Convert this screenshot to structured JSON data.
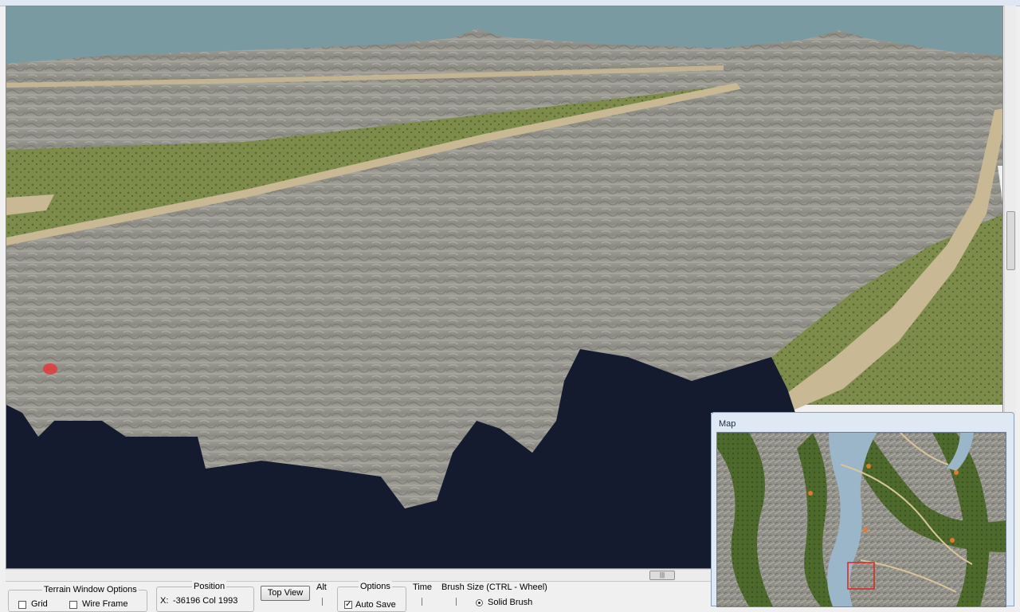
{
  "app": {
    "title_bar_text": ""
  },
  "terrain_window_options": {
    "title": "Terrain Window Options",
    "grid_label": "Grid",
    "grid_checked": false,
    "wireframe_label": "Wire Frame",
    "wireframe_checked": false
  },
  "position": {
    "title": "Position",
    "x_label": "X:",
    "x_value": "-36196 Col 1993"
  },
  "top_view": {
    "label": "Top View"
  },
  "alt": {
    "label": "Alt"
  },
  "options": {
    "title": "Options",
    "auto_save_label": "Auto Save",
    "auto_save_checked": true
  },
  "time": {
    "label": "Time"
  },
  "brush": {
    "title": "Brush Size (CTRL - Wheel)",
    "solid_brush_label": "Solid Brush",
    "solid_brush_selected": true
  },
  "hscroll": {
    "grip": "|||"
  },
  "map": {
    "title": "Map",
    "markers": 5
  },
  "colors": {
    "water": "#141b2e",
    "sky": "#7a9aa2",
    "rock": "#8e8e86",
    "grass": "#7d8c4a",
    "sand": "#c8b893",
    "map_water": "#9cb6c9",
    "cursor": "#e23b3b"
  },
  "icons": [
    "checkbox-icon",
    "radio-icon",
    "brush-cursor-icon",
    "map-marker-icon",
    "view-rectangle-icon"
  ]
}
